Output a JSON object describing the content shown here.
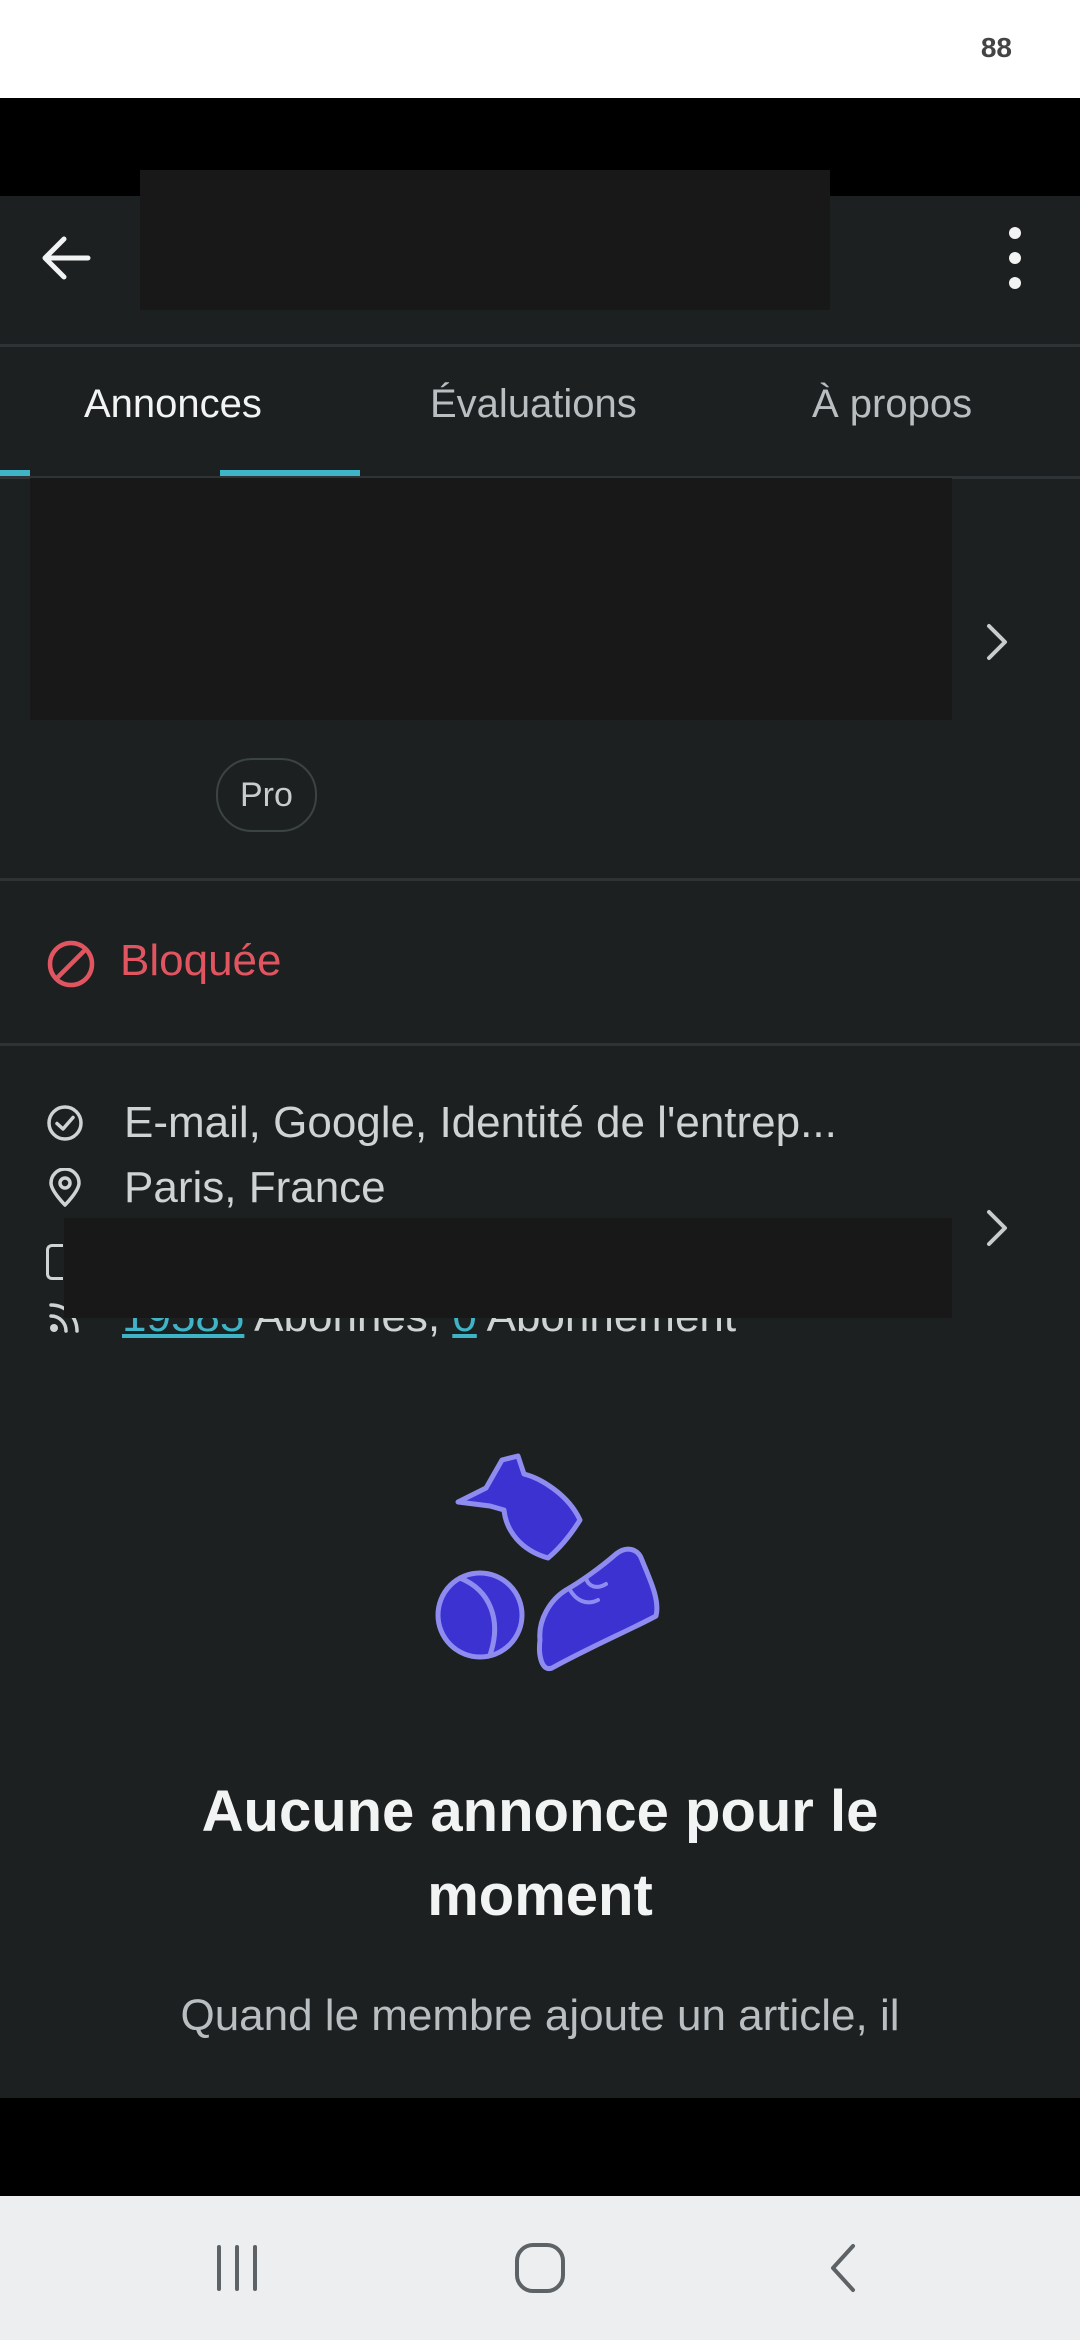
{
  "status_bar": {
    "right_text": "88"
  },
  "tabs": [
    {
      "label": "Annonces",
      "active": true
    },
    {
      "label": "Évaluations",
      "active": false
    },
    {
      "label": "À propos",
      "active": false
    }
  ],
  "profile": {
    "badge": "Pro",
    "stars_color": "#e0a82d"
  },
  "blocked": {
    "label": "Bloquée",
    "color": "#e15561"
  },
  "info": {
    "verified": "E-mail, Google, Identité de l'entrep...",
    "location": "Paris, France",
    "followers_count": "19585",
    "followers_label": " Abonnés, ",
    "following_count": "0",
    "following_label": " Abonnement"
  },
  "empty_state": {
    "title": "Aucune annonce pour le moment",
    "subtitle": "Quand le membre ajoute un article, il apparaît ici"
  },
  "colors": {
    "accent": "#3fb4c6",
    "illustration": "#3b32d1",
    "background": "#1c2021"
  }
}
